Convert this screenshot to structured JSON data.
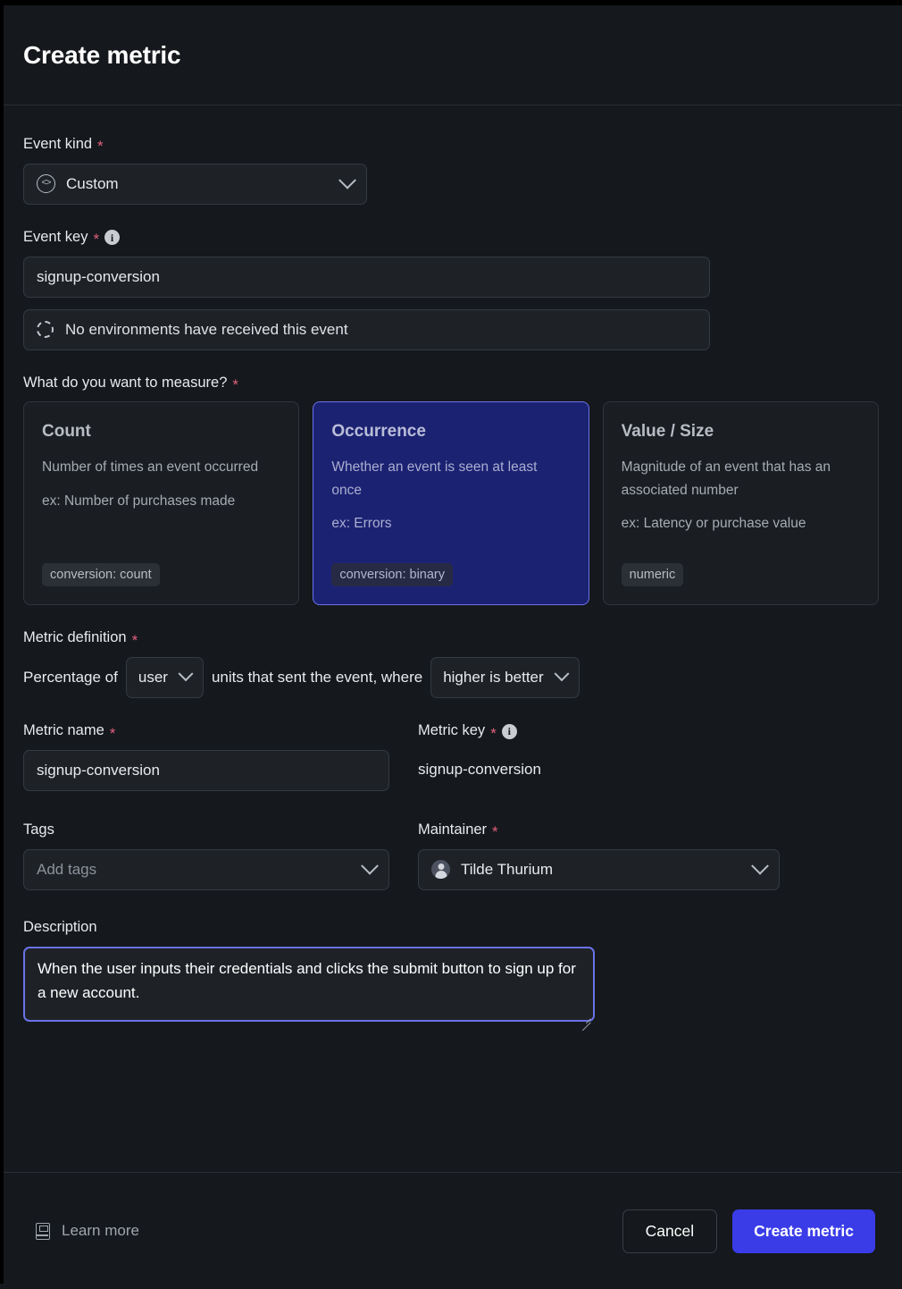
{
  "header": {
    "title": "Create metric"
  },
  "event_kind": {
    "label": "Event kind",
    "required": "*",
    "value": "Custom",
    "icon": "code-circle-icon"
  },
  "event_key": {
    "label": "Event key",
    "required": "*",
    "value": "signup-conversion",
    "status_message": "No environments have received this event",
    "status_icon": "spinner-icon"
  },
  "measure": {
    "label": "What do you want to measure?",
    "required": "*",
    "options": [
      {
        "title": "Count",
        "description": "Number of times an event occurred",
        "example": "ex: Number of purchases made",
        "badge": "conversion: count",
        "selected": false
      },
      {
        "title": "Occurrence",
        "description": "Whether an event is seen at least once",
        "example": "ex: Errors",
        "badge": "conversion: binary",
        "selected": true
      },
      {
        "title": "Value / Size",
        "description": "Magnitude of an event that has an associated number",
        "example": "ex: Latency or purchase value",
        "badge": "numeric",
        "selected": false
      }
    ]
  },
  "metric_definition": {
    "label": "Metric definition",
    "required": "*",
    "prefix_text": "Percentage of",
    "unit_value": "user",
    "middle_text": "units that sent the event, where",
    "direction_value": "higher is better"
  },
  "metric_name": {
    "label": "Metric name",
    "required": "*",
    "value": "signup-conversion"
  },
  "metric_key": {
    "label": "Metric key",
    "required": "*",
    "value": "signup-conversion"
  },
  "tags": {
    "label": "Tags",
    "placeholder": "Add tags",
    "value": "Add tags"
  },
  "maintainer": {
    "label": "Maintainer",
    "required": "*",
    "value": "Tilde Thurium",
    "icon": "user-avatar-icon"
  },
  "description": {
    "label": "Description",
    "value": "When the user inputs their credentials and clicks the submit button to sign up for a new account."
  },
  "footer": {
    "learn_more": "Learn more",
    "learn_more_icon": "book-icon",
    "cancel": "Cancel",
    "submit": "Create metric"
  },
  "colors": {
    "accent": "#3a3ce8",
    "selected_card_bg": "#1c2272",
    "selected_card_border": "#6a72e8",
    "required_asterisk": "#e0607e",
    "page_bg": "#15181c"
  }
}
